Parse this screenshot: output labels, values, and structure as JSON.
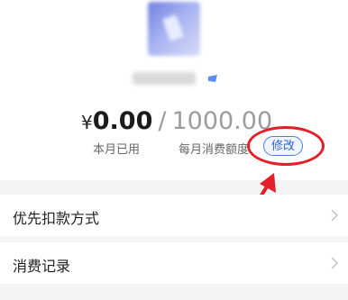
{
  "summary": {
    "currency_symbol": "¥",
    "used_amount": "0.00",
    "separator": "/",
    "quota_amount": "1000.00",
    "used_label": "本月已用",
    "quota_label": "每月消费额度",
    "modify_label": "修改"
  },
  "menu": {
    "items": [
      {
        "label": "优先扣款方式"
      },
      {
        "label": "消费记录"
      }
    ]
  },
  "annotation": {
    "highlight_color": "#e2202a"
  },
  "icons": {
    "verify": "verified-badge-icon",
    "chevron": "chevron-right-icon"
  }
}
